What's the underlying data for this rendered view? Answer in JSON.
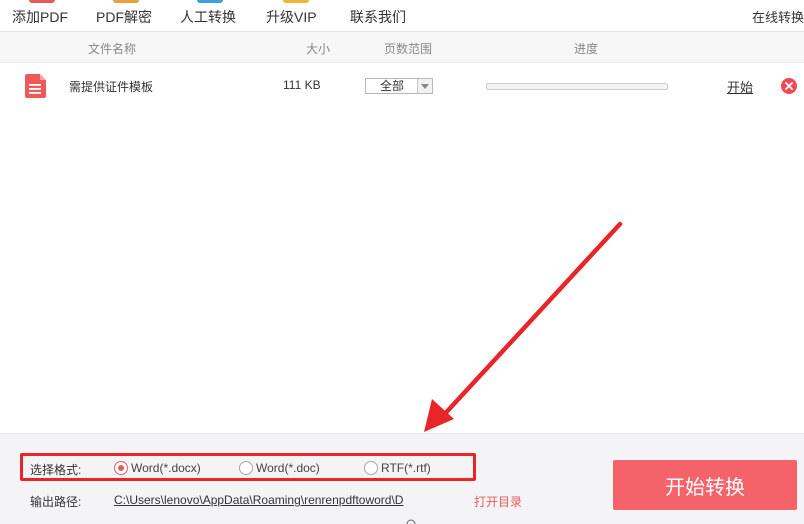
{
  "toolbar": {
    "items": [
      {
        "label": "添加PDF"
      },
      {
        "label": "PDF解密"
      },
      {
        "label": "人工转换"
      },
      {
        "label": "升级VIP"
      },
      {
        "label": "联系我们"
      }
    ],
    "online_link": "在线转换"
  },
  "table": {
    "headers": {
      "name": "文件名称",
      "size": "大小",
      "pages": "页数范围",
      "progress": "进度"
    },
    "rows": [
      {
        "name": "需提供证件模板",
        "size": "111 KB",
        "pages": "全部",
        "progress": 0,
        "start": "开始"
      }
    ]
  },
  "bottom": {
    "format_label": "选择格式:",
    "formats": [
      {
        "label": "Word(*.docx)",
        "selected": true
      },
      {
        "label": "Word(*.doc)",
        "selected": false
      },
      {
        "label": "RTF(*.rtf)",
        "selected": false
      }
    ],
    "output_label": "输出路径:",
    "output_path": "C:\\Users\\lenovo\\AppData\\Roaming\\renrenpdftoword\\D",
    "open_dir": "打开目录",
    "convert_button": "开始转换"
  },
  "colors": {
    "accent": "#f4636a",
    "annotation": "#e8262a"
  },
  "icons": {
    "file": "pdf-file-icon",
    "delete": "close-circle-icon",
    "dropdown": "chevron-down-icon"
  }
}
